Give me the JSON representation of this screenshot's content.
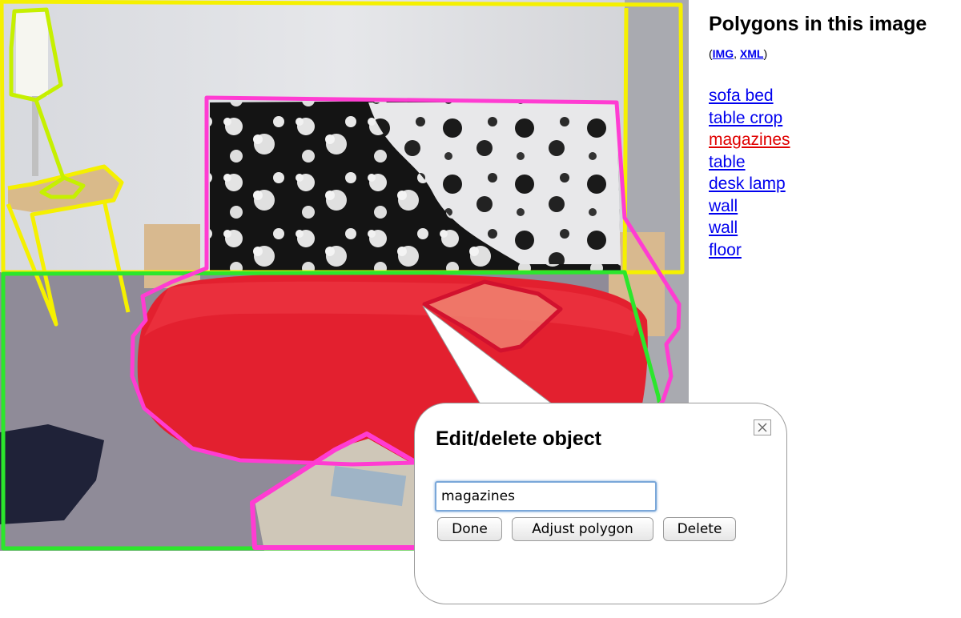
{
  "colors": {
    "link": "#0000ee",
    "selected_link": "#e00000",
    "polygon_yellow": "#f5f000",
    "polygon_magenta": "#ff3cd2",
    "polygon_green": "#2ce62c",
    "polygon_lime": "#c6f000",
    "polygon_selected": "#d2112e"
  },
  "sidebar": {
    "title": "Polygons in this image",
    "export": {
      "open": "(",
      "img": "IMG",
      "sep": ", ",
      "xml": "XML",
      "close": ")"
    },
    "objects": [
      {
        "label": "sofa bed",
        "selected": false
      },
      {
        "label": "table crop",
        "selected": false
      },
      {
        "label": "magazines",
        "selected": true
      },
      {
        "label": "table",
        "selected": false
      },
      {
        "label": "desk lamp",
        "selected": false
      },
      {
        "label": "wall",
        "selected": false
      },
      {
        "label": "wall",
        "selected": false
      },
      {
        "label": "floor",
        "selected": false
      }
    ]
  },
  "popup": {
    "title": "Edit/delete object",
    "close_icon": "close-x-icon",
    "name_value": "magazines",
    "done_label": "Done",
    "adjust_label": "Adjust polygon",
    "delete_label": "Delete"
  }
}
